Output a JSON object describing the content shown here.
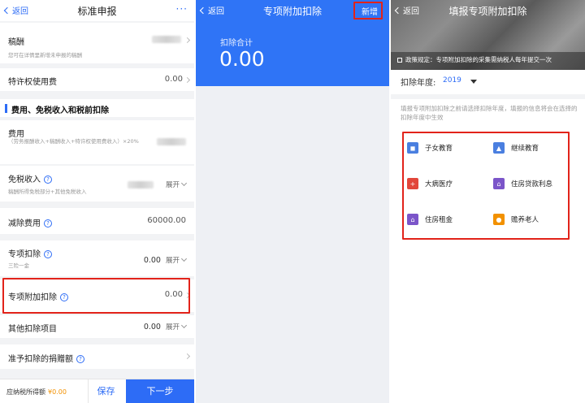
{
  "colors": {
    "brand_blue": "#2d6cf6",
    "header_blue": "#2f74f6",
    "highlight_red": "#e2231a",
    "amount_orange": "#f29100"
  },
  "p1": {
    "back": "返回",
    "title": "标准申报",
    "more": "···",
    "royalty": {
      "label": "稿酬",
      "note": "您可在详情里新增未申报的稿酬"
    },
    "franchise": {
      "label": "特许权使用费",
      "value": "0.00"
    },
    "section_title": "费用、免税收入和税前扣除",
    "expense": {
      "label": "费用",
      "note": "（劳务报酬收入+稿酬收入+特许权使用费收入）×20%"
    },
    "taxfree": {
      "label": "免税收入",
      "note": "稿酬所得免税部分+其他免税收入",
      "expand": "展开"
    },
    "deduction": {
      "label": "减除费用",
      "value": "60000.00"
    },
    "special": {
      "label": "专项扣除",
      "note": "三险一金",
      "value": "0.00",
      "expand": "展开"
    },
    "additional": {
      "label": "专项附加扣除",
      "value": "0.00"
    },
    "other": {
      "label": "其他扣除项目",
      "value": "0.00",
      "expand": "展开"
    },
    "donation": {
      "label": "准予扣除的捐赠额"
    },
    "footer": {
      "tax_label": "应纳税所得额",
      "tax_value": "¥0.00",
      "save": "保存",
      "next": "下一步"
    }
  },
  "p2": {
    "back": "返回",
    "title": "专项附加扣除",
    "add": "新增",
    "sum_label": "扣除合计",
    "sum_value": "0.00"
  },
  "p3": {
    "back": "返回",
    "title": "填报专项附加扣除",
    "notice": "政策规定：专项附加扣除的采集需纳税人每年提交一次",
    "notice_icon": "speaker-icon",
    "year_label": "扣除年度:",
    "year_value": "2019",
    "hint": "填报专项附加扣除之前请选择扣除年度，填报的信息将会在选择的扣除年度中生效",
    "items": [
      {
        "label": "子女教育",
        "icon": "children-education-icon",
        "color": "#4a7fe0"
      },
      {
        "label": "继续教育",
        "icon": "graduation-cap-icon",
        "color": "#4a7fe0"
      },
      {
        "label": "大病医疗",
        "icon": "medical-kit-icon",
        "color": "#e2463a"
      },
      {
        "label": "住房贷款利息",
        "icon": "house-loan-icon",
        "color": "#7b55c9"
      },
      {
        "label": "住房租金",
        "icon": "house-rent-icon",
        "color": "#7b55c9"
      },
      {
        "label": "赡养老人",
        "icon": "elderly-care-icon",
        "color": "#f29100"
      }
    ]
  }
}
